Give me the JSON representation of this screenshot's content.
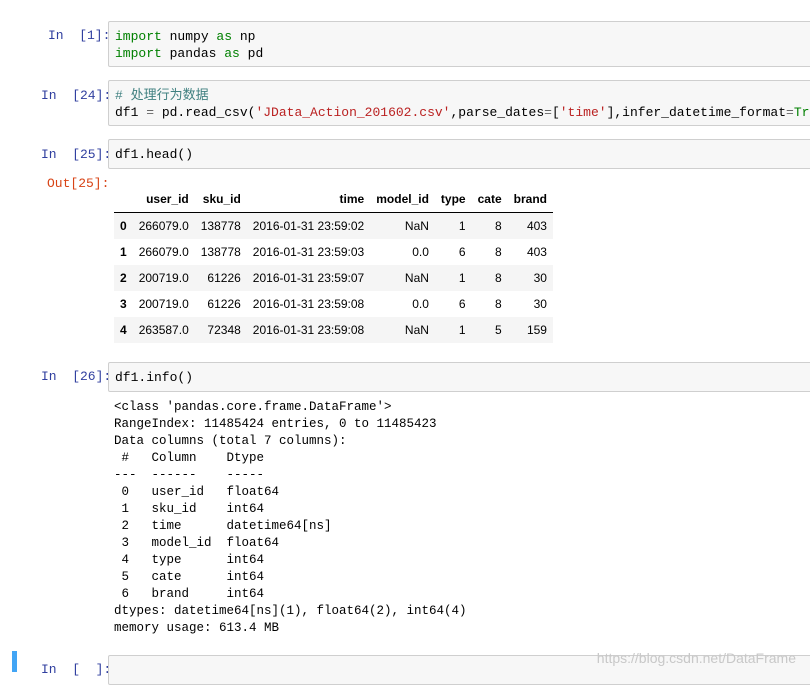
{
  "cells": [
    {
      "prompt": "In  [1]:",
      "lines": [
        [
          {
            "t": "import",
            "c": "kw"
          },
          {
            "t": " numpy ",
            "c": ""
          },
          {
            "t": "as",
            "c": "kw"
          },
          {
            "t": " np",
            "c": ""
          }
        ],
        [
          {
            "t": "import",
            "c": "kw"
          },
          {
            "t": " pandas ",
            "c": ""
          },
          {
            "t": "as",
            "c": "kw"
          },
          {
            "t": " pd",
            "c": ""
          }
        ]
      ]
    },
    {
      "prompt": "In  [24]:",
      "lines": [
        [
          {
            "t": "# 处理行为数据",
            "c": "cmt"
          }
        ],
        [
          {
            "t": "df1 ",
            "c": ""
          },
          {
            "t": "=",
            "c": "op"
          },
          {
            "t": " pd.read_csv(",
            "c": ""
          },
          {
            "t": "'JData_Action_201602.csv'",
            "c": "str"
          },
          {
            "t": ",parse_dates",
            "c": ""
          },
          {
            "t": "=",
            "c": "op"
          },
          {
            "t": "[",
            "c": ""
          },
          {
            "t": "'time'",
            "c": "str"
          },
          {
            "t": "],infer_datetime_format",
            "c": ""
          },
          {
            "t": "=",
            "c": "op"
          },
          {
            "t": "True",
            "c": "kwc"
          },
          {
            "t": ")",
            "c": ""
          }
        ]
      ]
    },
    {
      "prompt": "In  [25]:",
      "lines": [
        [
          {
            "t": "df1.head()",
            "c": ""
          }
        ]
      ]
    },
    {
      "prompt": "In  [26]:",
      "lines": [
        [
          {
            "t": "df1.info()",
            "c": ""
          }
        ]
      ]
    },
    {
      "prompt": "In  [  ]:",
      "lines": []
    }
  ],
  "out_prompt": "Out[25]:",
  "table": {
    "columns": [
      "",
      "user_id",
      "sku_id",
      "time",
      "model_id",
      "type",
      "cate",
      "brand"
    ],
    "rows": [
      [
        "0",
        "266079.0",
        "138778",
        "2016-01-31 23:59:02",
        "NaN",
        "1",
        "8",
        "403"
      ],
      [
        "1",
        "266079.0",
        "138778",
        "2016-01-31 23:59:03",
        "0.0",
        "6",
        "8",
        "403"
      ],
      [
        "2",
        "200719.0",
        "61226",
        "2016-01-31 23:59:07",
        "NaN",
        "1",
        "8",
        "30"
      ],
      [
        "3",
        "200719.0",
        "61226",
        "2016-01-31 23:59:08",
        "0.0",
        "6",
        "8",
        "30"
      ],
      [
        "4",
        "263587.0",
        "72348",
        "2016-01-31 23:59:08",
        "NaN",
        "1",
        "5",
        "159"
      ]
    ]
  },
  "info_output": [
    "<class 'pandas.core.frame.DataFrame'>",
    "RangeIndex: 11485424 entries, 0 to 11485423",
    "Data columns (total 7 columns):",
    " #   Column    Dtype",
    "---  ------    -----",
    " 0   user_id   float64",
    " 1   sku_id    int64",
    " 2   time      datetime64[ns]",
    " 3   model_id  float64",
    " 4   type      int64",
    " 5   cate      int64",
    " 6   brand     int64",
    "dtypes: datetime64[ns](1), float64(2), int64(4)",
    "memory usage: 613.4 MB"
  ],
  "watermark": "https://blog.csdn.net/DataFrame",
  "colors": {
    "prompt_in": "#303f9f",
    "prompt_out": "#d84315",
    "keyword": "#008000",
    "string": "#ba2121",
    "comment": "#408080",
    "active_cell_bar": "#42a5f5"
  }
}
